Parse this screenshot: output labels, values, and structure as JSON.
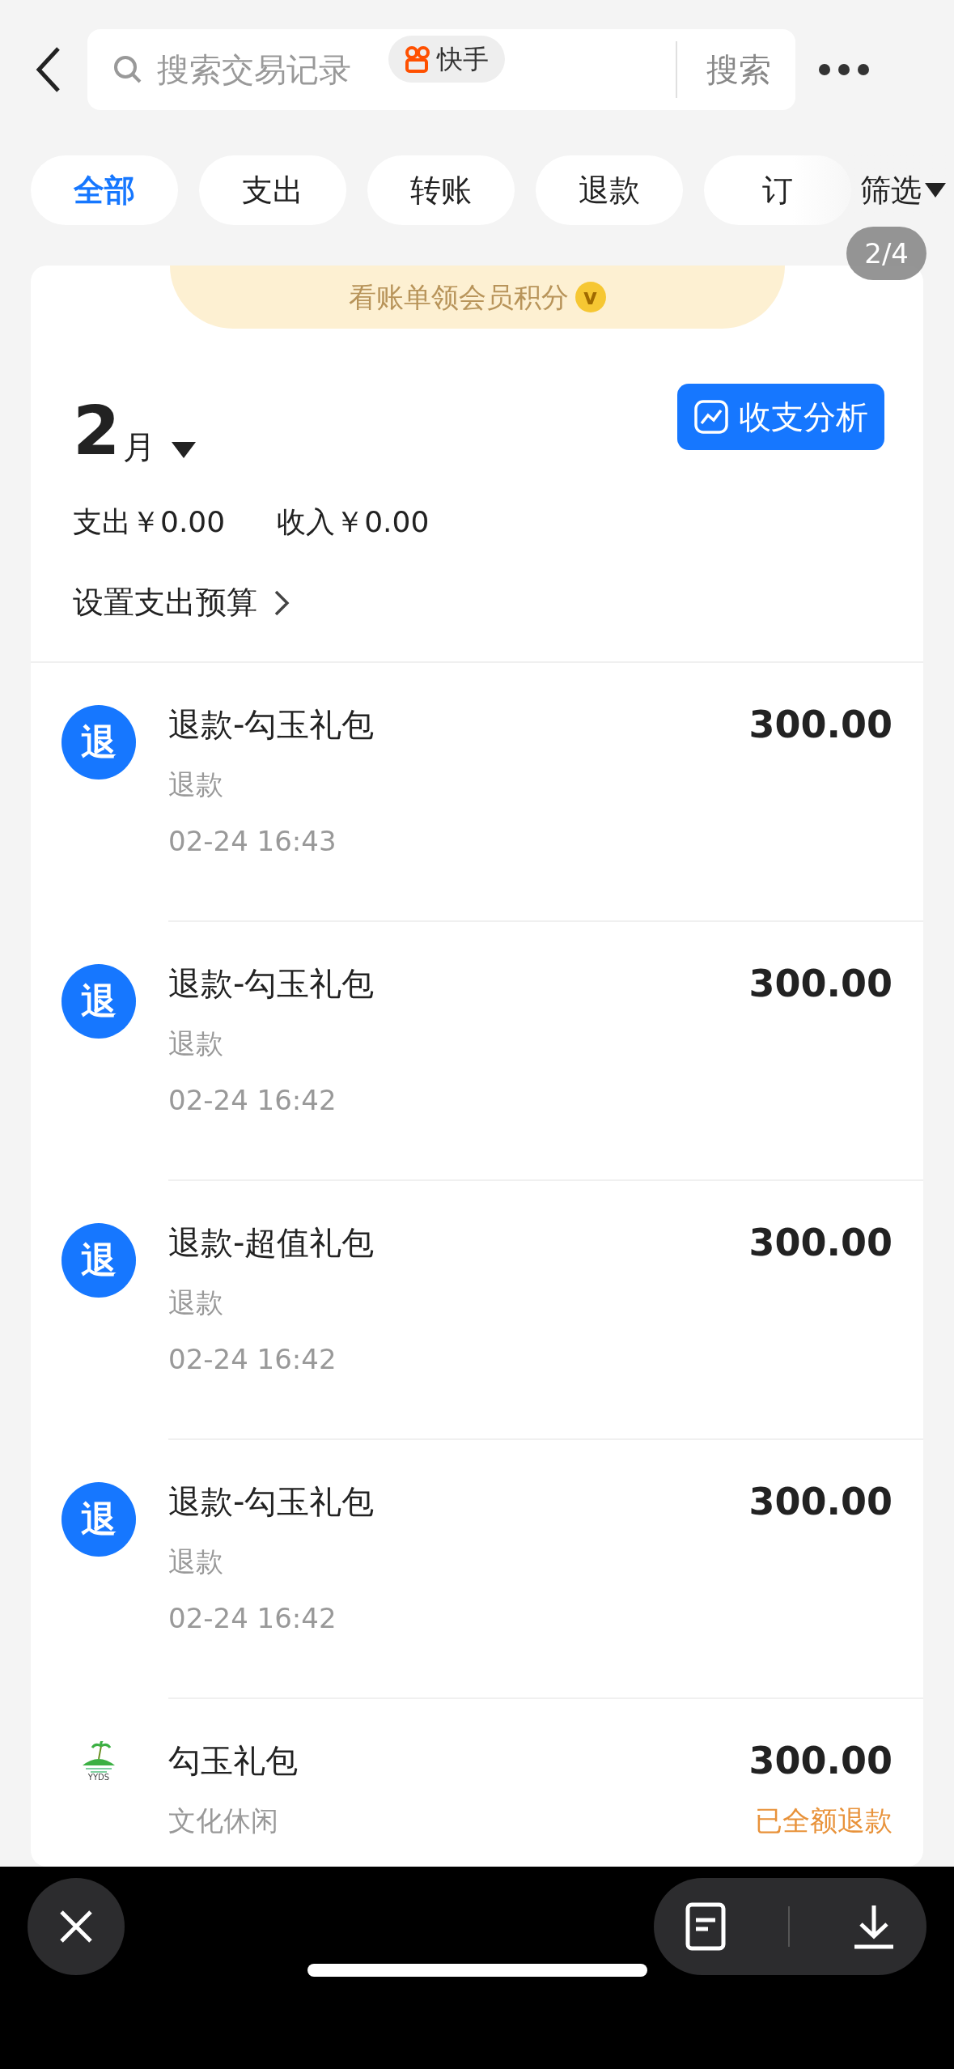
{
  "header": {
    "search_placeholder": "搜索交易记录",
    "app_badge": "快手",
    "search_button": "搜索"
  },
  "tabs": [
    {
      "label": "全部",
      "selected": true
    },
    {
      "label": "支出",
      "selected": false
    },
    {
      "label": "转账",
      "selected": false
    },
    {
      "label": "退款",
      "selected": false
    },
    {
      "label": "订",
      "selected": false
    }
  ],
  "filter": "筛选",
  "page_counter": "2/4",
  "banner": {
    "text": "看账单领会员积分",
    "coin": "v"
  },
  "summary": {
    "month": "2",
    "month_unit": "月",
    "analysis_button": "收支分析",
    "expense": "支出￥0.00",
    "income": "收入￥0.00",
    "budget_link": "设置支出预算"
  },
  "transactions": [
    {
      "kind": "refund",
      "icon_text": "退",
      "title": "退款-勾玉礼包",
      "category": "退款",
      "time": "02-24 16:43",
      "amount": "300.00"
    },
    {
      "kind": "refund",
      "icon_text": "退",
      "title": "退款-勾玉礼包",
      "category": "退款",
      "time": "02-24 16:42",
      "amount": "300.00"
    },
    {
      "kind": "refund",
      "icon_text": "退",
      "title": "退款-超值礼包",
      "category": "退款",
      "time": "02-24 16:42",
      "amount": "300.00"
    },
    {
      "kind": "refund",
      "icon_text": "退",
      "title": "退款-勾玉礼包",
      "category": "退款",
      "time": "02-24 16:42",
      "amount": "300.00"
    },
    {
      "kind": "merchant",
      "logo_text": "YYDS",
      "title": "勾玉礼包",
      "category": "文化休闲",
      "amount": "300.00",
      "status": "已全额退款"
    }
  ]
}
